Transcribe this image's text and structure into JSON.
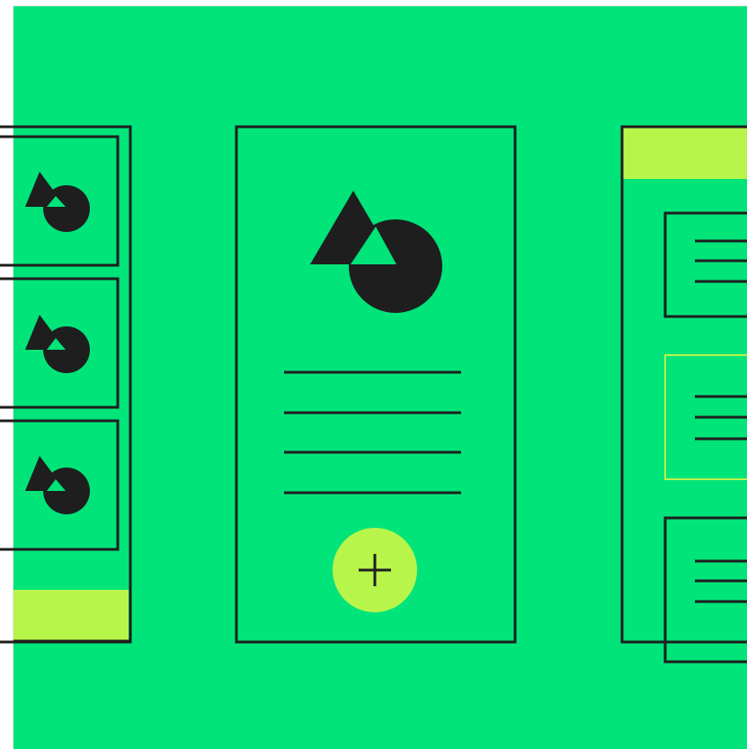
{
  "colors": {
    "background": "#00e47a",
    "accent": "#b8f54a",
    "stroke": "#1e1e1e",
    "page_border": "#e6e6e6"
  },
  "icons": {
    "media_shape": "triangle-circle-icon",
    "add": "plus-icon"
  },
  "left_card": {
    "thumbnails": [
      "triangle-circle-icon",
      "triangle-circle-icon",
      "triangle-circle-icon"
    ]
  },
  "center_card": {
    "text_line_count": 4,
    "action": "plus-icon"
  },
  "right_card": {
    "list_item_count": 3,
    "highlighted_item": 2
  }
}
